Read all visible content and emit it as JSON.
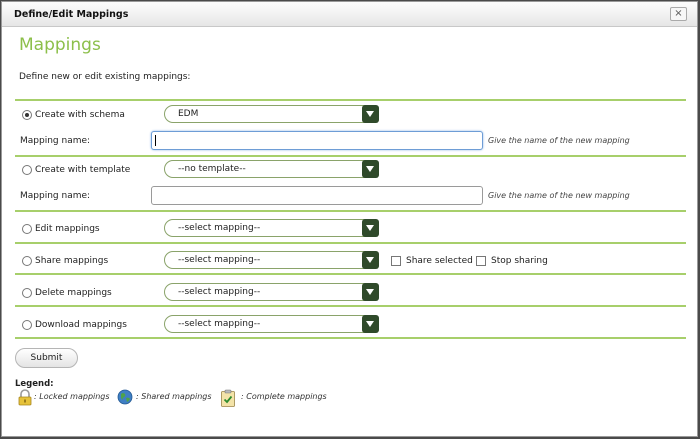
{
  "window": {
    "title": "Define/Edit Mappings",
    "close_label": "×"
  },
  "header": {
    "title": "Mappings",
    "intro": "Define new or edit existing mappings:"
  },
  "create_schema": {
    "label": "Create with schema",
    "selected": true,
    "select_value": "EDM",
    "name_label": "Mapping name:",
    "name_value": "",
    "hint": "Give the name of the new mapping"
  },
  "create_template": {
    "label": "Create with template",
    "selected": false,
    "select_value": "--no template--",
    "name_label": "Mapping name:",
    "name_value": "",
    "hint": "Give the name of the new mapping"
  },
  "edit": {
    "label": "Edit mappings",
    "select_value": "--select mapping--"
  },
  "share": {
    "label": "Share mappings",
    "select_value": "--select mapping--",
    "share_selected_label": "Share selected",
    "stop_sharing_label": "Stop sharing"
  },
  "delete": {
    "label": "Delete mappings",
    "select_value": "--select mapping--"
  },
  "download": {
    "label": "Download mappings",
    "select_value": "--select mapping--"
  },
  "submit_label": "Submit",
  "legend": {
    "title": "Legend:",
    "locked": ": Locked mappings",
    "shared": ": Shared mappings",
    "complete": ": Complete mappings"
  },
  "colors": {
    "accent": "#8cbf4a",
    "divider": "#a7cf6b",
    "select_arrow": "#2f4a2a"
  }
}
